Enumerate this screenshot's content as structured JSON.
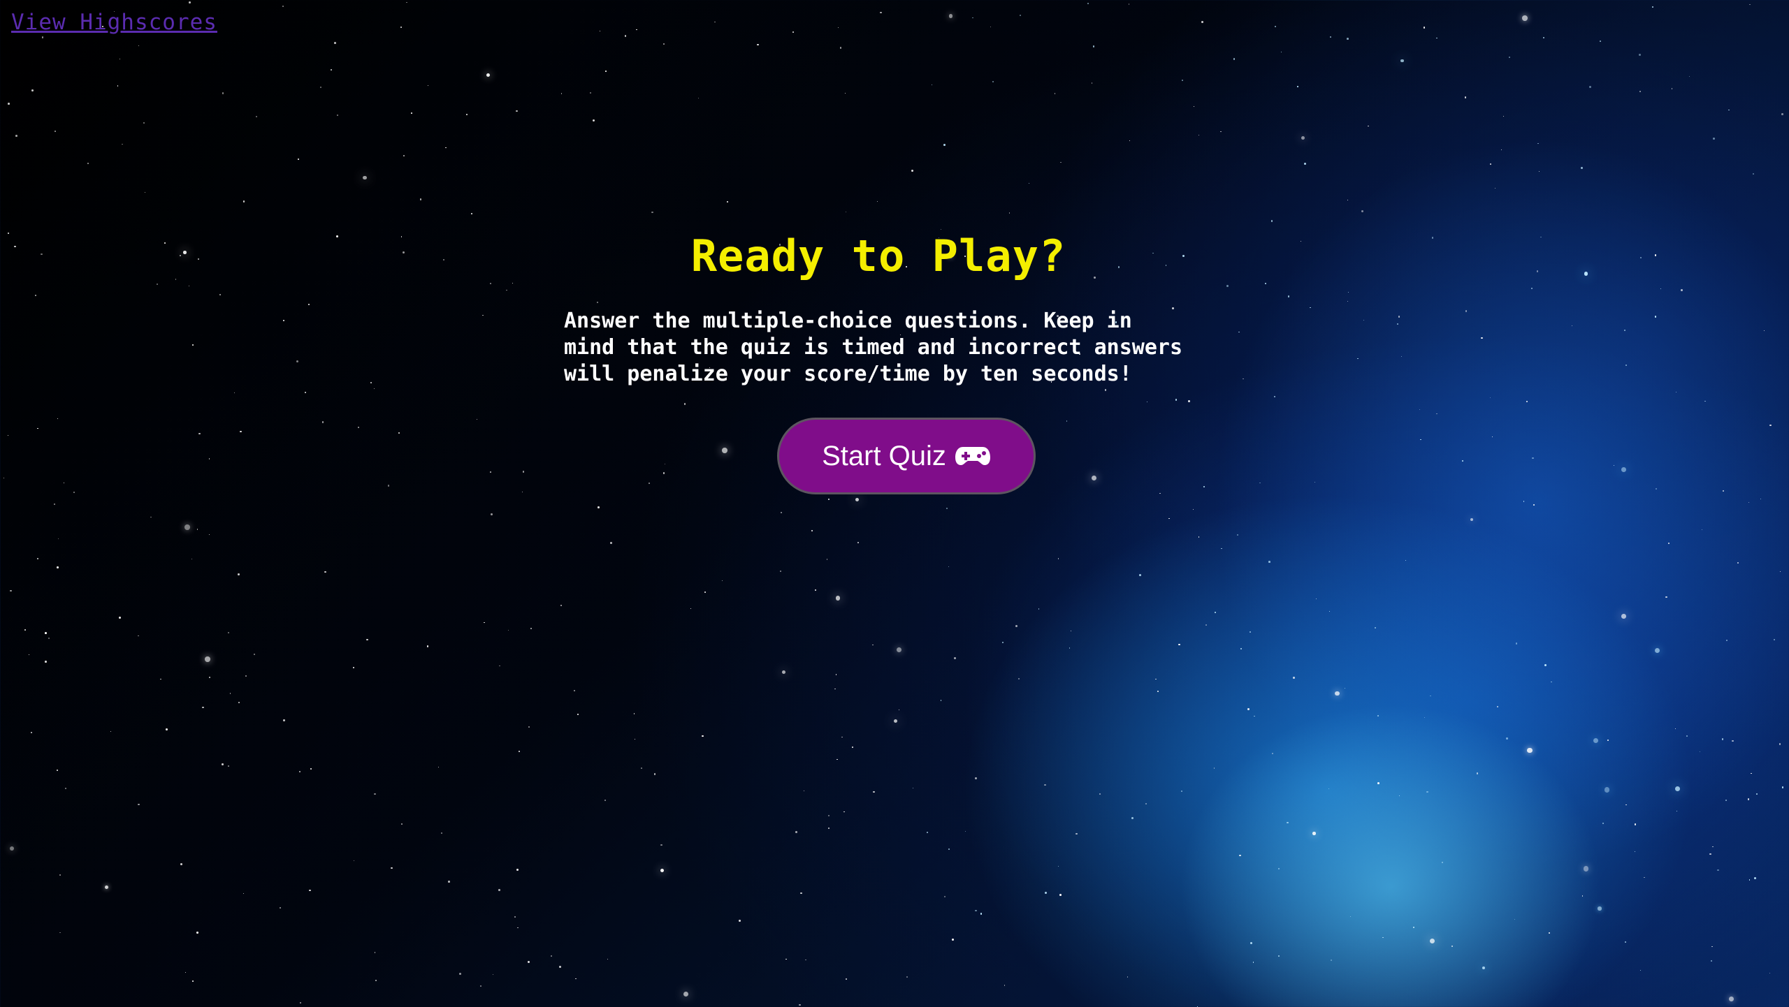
{
  "nav": {
    "highscores_label": "View Highscores"
  },
  "intro": {
    "title": "Ready to Play?",
    "instructions": "Answer the multiple-choice questions. Keep in mind that the quiz is timed and incorrect answers will penalize your score/time by ten seconds!",
    "start_button_label": "Start Quiz",
    "start_button_icon": "gamepad-icon"
  },
  "colors": {
    "title": "#f4ee00",
    "button_background": "#800d8a",
    "link": "#5b2cb0",
    "background": "#01030a"
  }
}
